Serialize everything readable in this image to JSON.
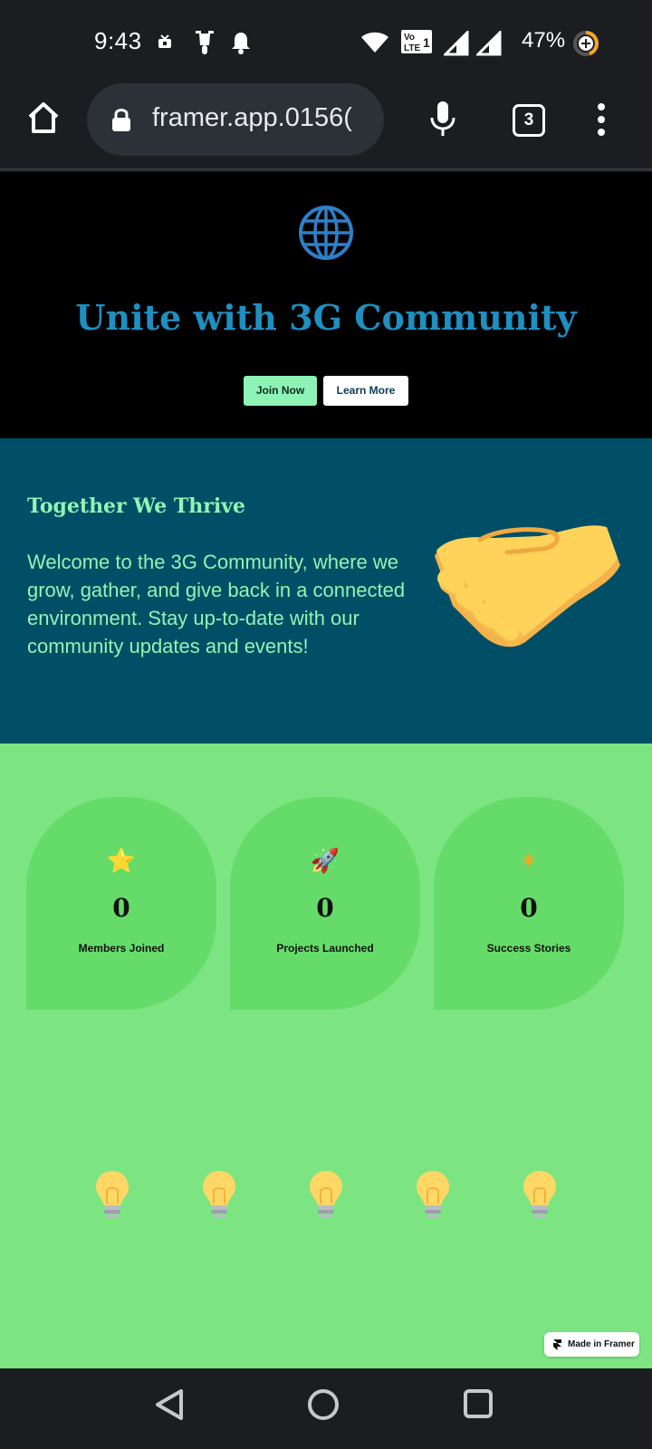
{
  "status_bar": {
    "time": "9:43",
    "battery_percent": "47%",
    "icons": [
      "notification-icon",
      "scooter-icon",
      "bell-icon",
      "wifi-icon",
      "volte-icon",
      "signal-icon",
      "signal-icon",
      "battery-icon"
    ]
  },
  "browser": {
    "url": ")0156.framer.app",
    "tab_count": "3",
    "icons": [
      "home-icon",
      "lock-icon",
      "mic-icon",
      "tabs-icon",
      "more-icon"
    ]
  },
  "hero": {
    "icon": "globe-icon",
    "title": "Unite with 3G Community",
    "join_label": "Join Now",
    "learn_label": "Learn More"
  },
  "thrive": {
    "title": "Together We Thrive",
    "body": "Welcome to the 3G Community, where we grow, gather, and give back in a connected environment. Stay up-to-date with our community updates and events!",
    "image": "handshake-icon"
  },
  "stats": {
    "cards": [
      {
        "icon": "star-icon",
        "glyph": "⭐",
        "value": "0",
        "label": "Members Joined"
      },
      {
        "icon": "rocket-icon",
        "glyph": "🚀",
        "value": "0",
        "label": "Projects Launched"
      },
      {
        "icon": "sparkle-icon",
        "glyph": "✴",
        "value": "0",
        "label": "Success Stories"
      }
    ],
    "bulb_count": 5
  },
  "badge": {
    "label": "Made in Framer"
  },
  "nav": {
    "icons": [
      "back-icon",
      "home-circle-icon",
      "recents-icon"
    ]
  },
  "colors": {
    "hero_title": "#1e8fc0",
    "thrive_bg": "#004f66",
    "thrive_text": "#92f4b3",
    "stats_bg": "#7ce582",
    "card_bg": "#65dc6a",
    "join_button": "#8df3b6"
  }
}
